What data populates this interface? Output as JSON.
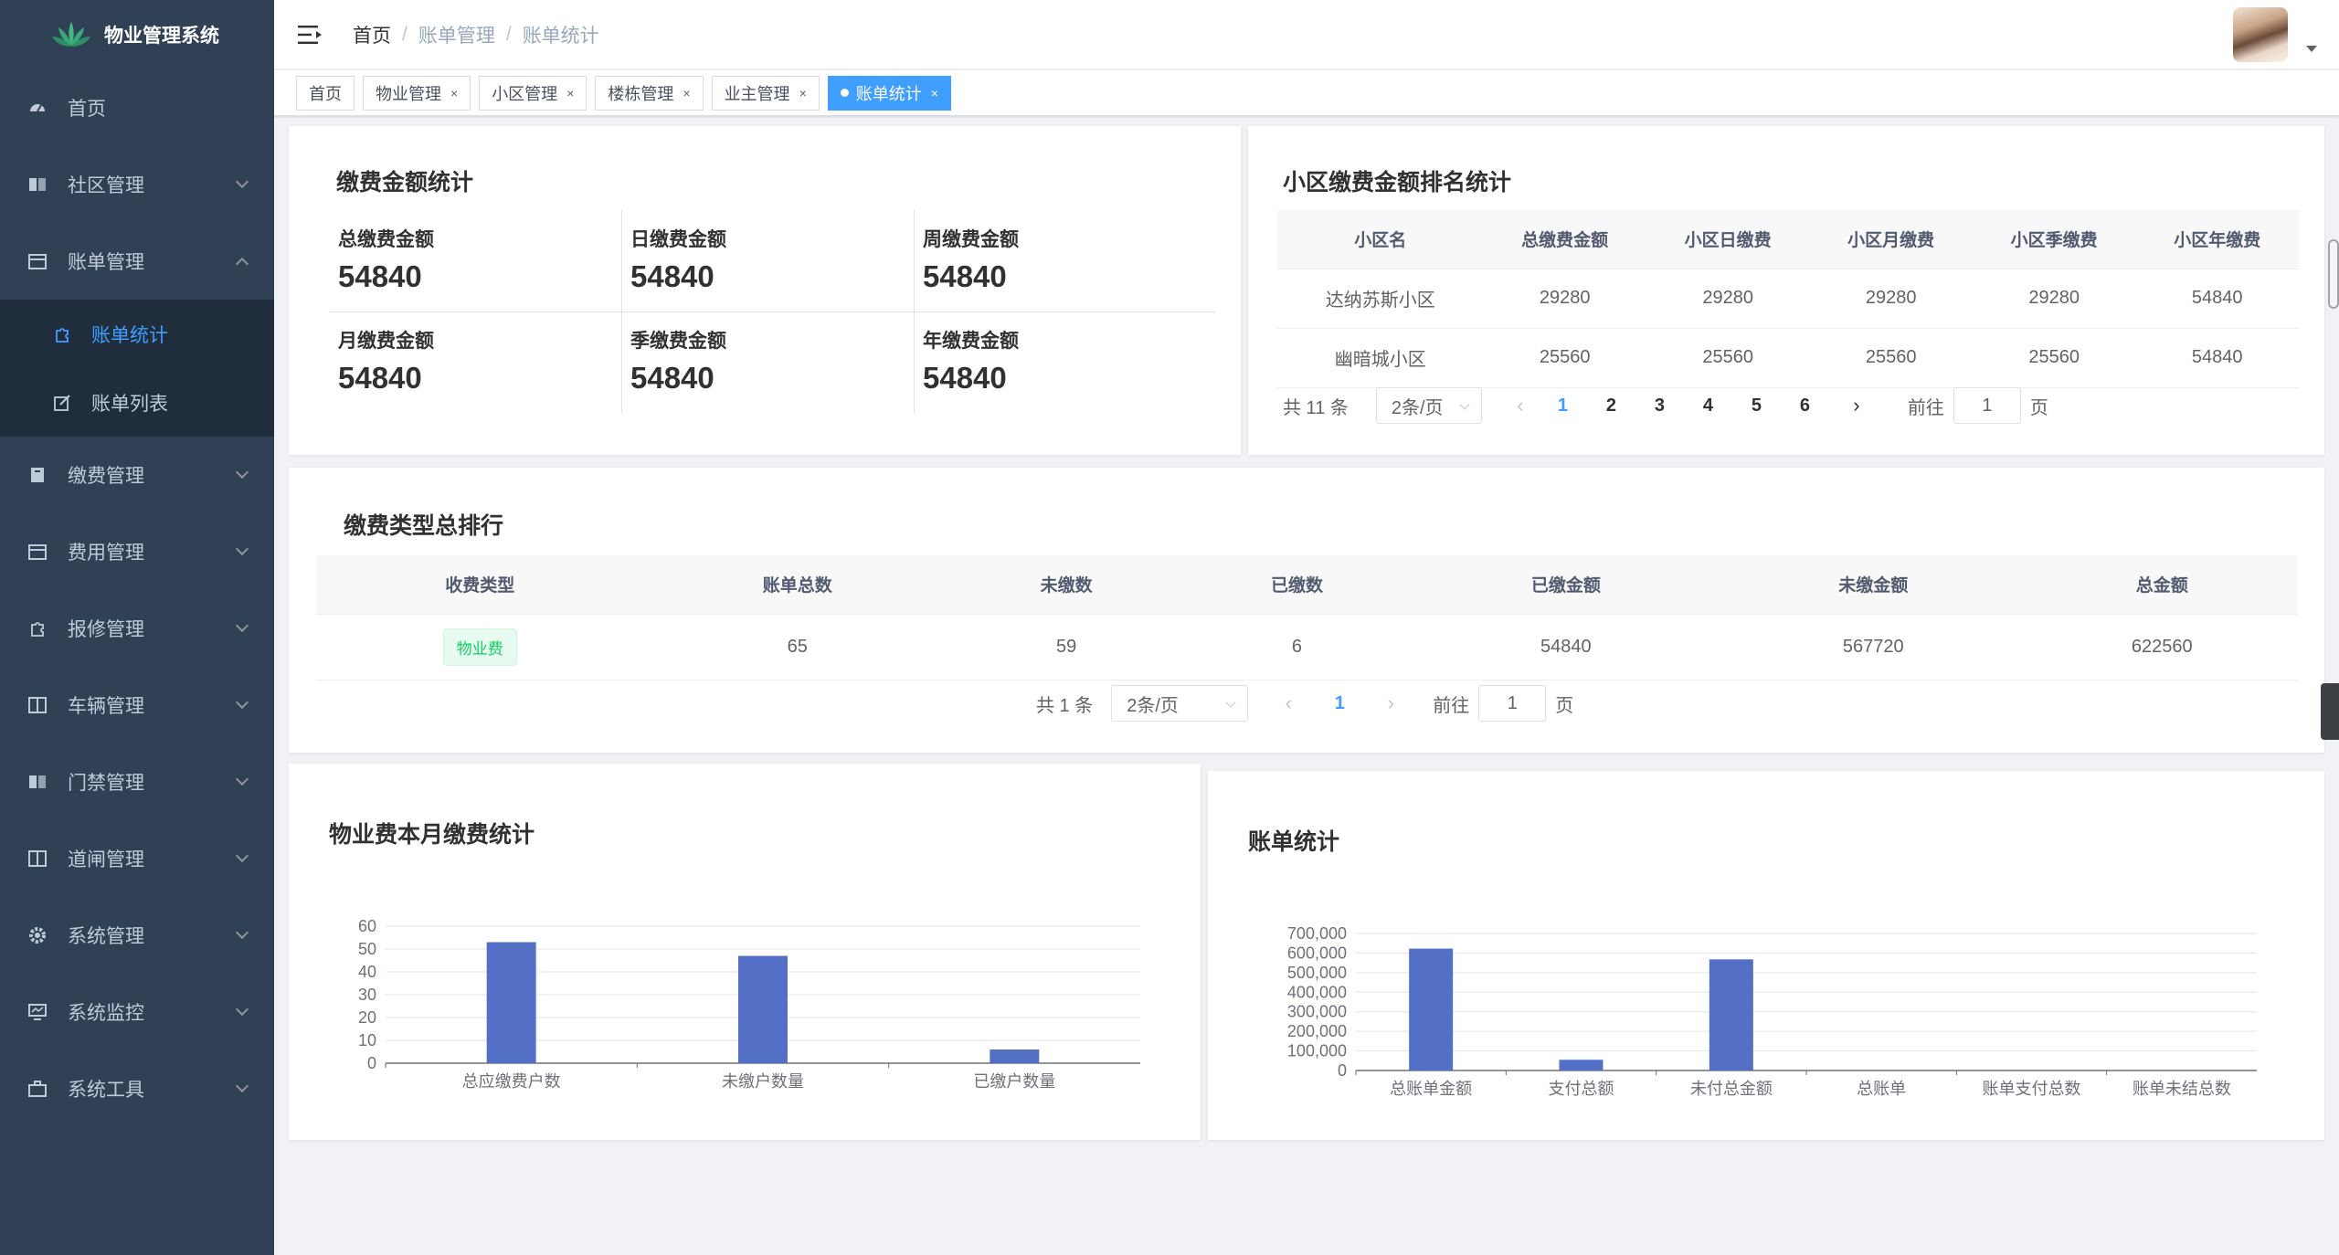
{
  "app": {
    "title": "物业管理系统"
  },
  "sidebar": {
    "items": [
      {
        "label": "首页",
        "icon": "dashboard-icon"
      },
      {
        "label": "社区管理",
        "icon": "book-icon"
      },
      {
        "label": "账单管理",
        "icon": "calendar-icon",
        "expanded": true,
        "children": [
          {
            "label": "账单统计",
            "active": true
          },
          {
            "label": "账单列表"
          }
        ]
      },
      {
        "label": "缴费管理",
        "icon": "document-icon"
      },
      {
        "label": "费用管理",
        "icon": "calendar-icon"
      },
      {
        "label": "报修管理",
        "icon": "tool-icon"
      },
      {
        "label": "车辆管理",
        "icon": "panel-icon"
      },
      {
        "label": "门禁管理",
        "icon": "book-icon"
      },
      {
        "label": "道闸管理",
        "icon": "panel-icon"
      },
      {
        "label": "系统管理",
        "icon": "gear-icon"
      },
      {
        "label": "系统监控",
        "icon": "monitor-icon"
      },
      {
        "label": "系统工具",
        "icon": "toolbox-icon"
      }
    ]
  },
  "header": {
    "breadcrumb": [
      "首页",
      "账单管理",
      "账单统计"
    ]
  },
  "tags": [
    {
      "label": "首页",
      "closable": false
    },
    {
      "label": "物业管理",
      "closable": true
    },
    {
      "label": "小区管理",
      "closable": true
    },
    {
      "label": "楼栋管理",
      "closable": true
    },
    {
      "label": "业主管理",
      "closable": true
    },
    {
      "label": "账单统计",
      "closable": true,
      "active": true
    }
  ],
  "amount_stats": {
    "title": "缴费金额统计",
    "cells": [
      {
        "label": "总缴费金额",
        "value": "54840"
      },
      {
        "label": "日缴费金额",
        "value": "54840"
      },
      {
        "label": "周缴费金额",
        "value": "54840"
      },
      {
        "label": "月缴费金额",
        "value": "54840"
      },
      {
        "label": "季缴费金额",
        "value": "54840"
      },
      {
        "label": "年缴费金额",
        "value": "54840"
      }
    ]
  },
  "ranking": {
    "title": "小区缴费金额排名统计",
    "columns": [
      "小区名",
      "总缴费金额",
      "小区日缴费",
      "小区月缴费",
      "小区季缴费",
      "小区年缴费"
    ],
    "rows": [
      [
        "达纳苏斯小区",
        "29280",
        "29280",
        "29280",
        "29280",
        "54840"
      ],
      [
        "幽暗城小区",
        "25560",
        "25560",
        "25560",
        "25560",
        "54840"
      ]
    ],
    "pager": {
      "total": "共 11 条",
      "size": "2条/页",
      "pages": [
        "1",
        "2",
        "3",
        "4",
        "5",
        "6"
      ],
      "current": "1",
      "goto_label": "前往",
      "goto_value": "1",
      "page_unit": "页",
      "prev": "‹",
      "next": "›"
    }
  },
  "type_rank": {
    "title": "缴费类型总排行",
    "columns": [
      "收费类型",
      "账单总数",
      "未缴数",
      "已缴数",
      "已缴金额",
      "未缴金额",
      "总金额"
    ],
    "rows": [
      [
        "物业费",
        "65",
        "59",
        "6",
        "54840",
        "567720",
        "622560"
      ]
    ],
    "pager": {
      "total": "共 1 条",
      "size": "2条/页",
      "pages": [
        "1"
      ],
      "current": "1",
      "goto_label": "前往",
      "goto_value": "1",
      "page_unit": "页",
      "prev": "‹",
      "next": "›"
    }
  },
  "chart_data": [
    {
      "type": "bar",
      "title": "物业费本月缴费统计",
      "categories": [
        "总应缴费户数",
        "未缴户数量",
        "已缴户数量"
      ],
      "values": [
        53,
        47,
        6
      ],
      "ylim": [
        0,
        60
      ],
      "yticks": [
        "0",
        "10",
        "20",
        "30",
        "40",
        "50",
        "60"
      ],
      "grid": true,
      "color": "#5470c6"
    },
    {
      "type": "bar",
      "title": "账单统计",
      "categories": [
        "总账单金额",
        "支付总额",
        "未付总金额",
        "总账单",
        "账单支付总数",
        "账单未结总数"
      ],
      "values": [
        622560,
        54840,
        567720,
        65,
        6,
        59
      ],
      "ylim": [
        0,
        700000
      ],
      "yticks": [
        "0",
        "100,000",
        "200,000",
        "300,000",
        "400,000",
        "500,000",
        "600,000",
        "700,000"
      ],
      "grid": true,
      "color": "#5470c6"
    }
  ]
}
